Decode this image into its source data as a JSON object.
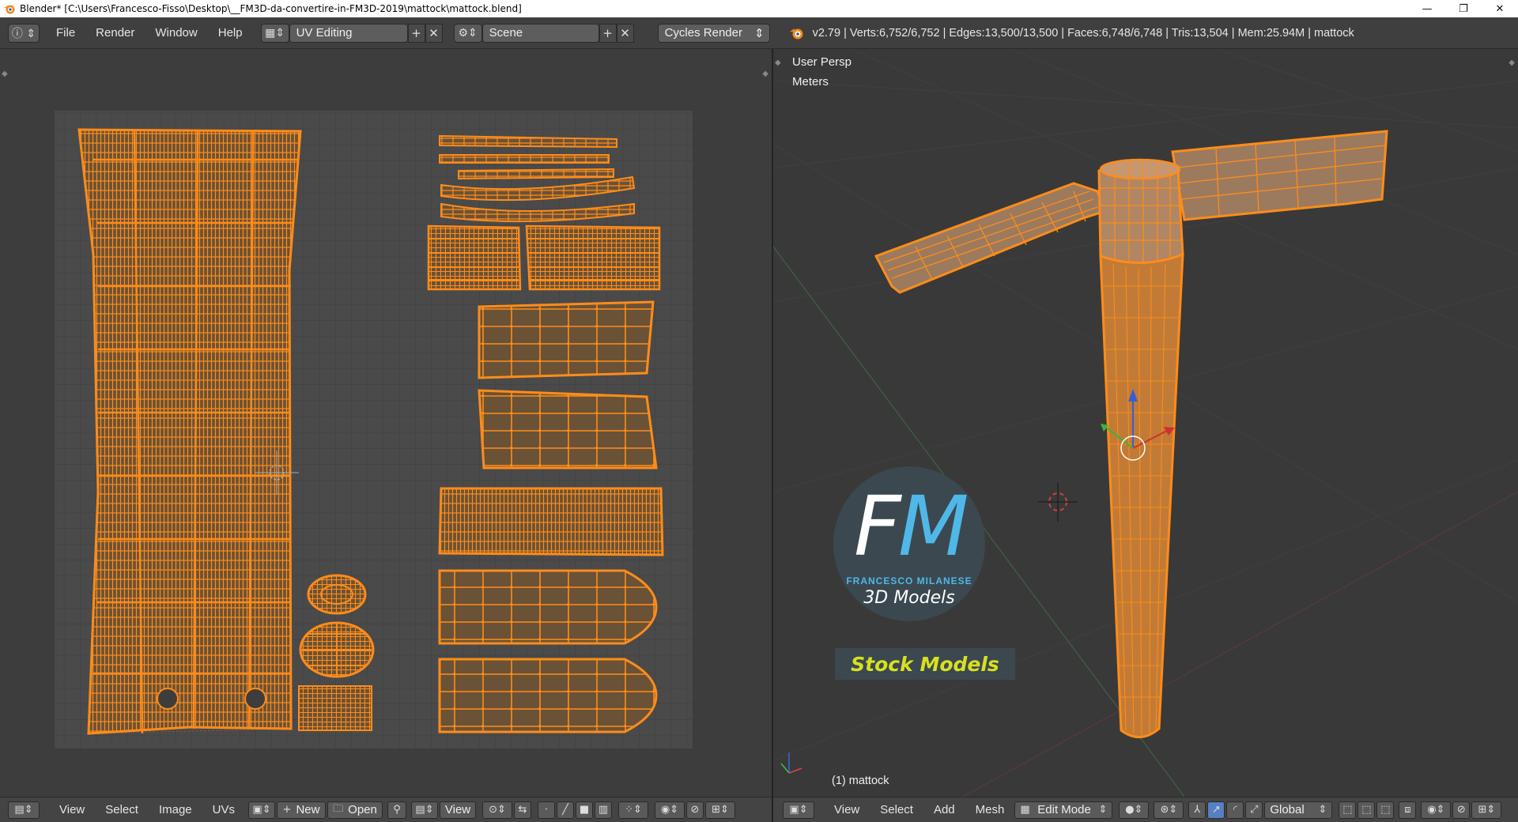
{
  "window": {
    "title": "Blender* [C:\\Users\\Francesco-Fisso\\Desktop\\__FM3D-da-convertire-in-FM3D-2019\\mattock\\mattock.blend]",
    "minimize": "—",
    "maximize": "❐",
    "close": "✕"
  },
  "header": {
    "menus": [
      "File",
      "Render",
      "Window",
      "Help"
    ],
    "screen_layout": "UV Editing",
    "scene": "Scene",
    "render_engine": "Cycles Render",
    "stats": "v2.79 | Verts:6,752/6,752 | Edges:13,500/13,500 | Faces:6,748/6,748 | Tris:13,504 | Mem:25.94M | mattock"
  },
  "viewport": {
    "view_name": "User Persp",
    "units": "Meters",
    "object_label": "(1) mattock",
    "watermark": {
      "logo": "FM",
      "brand": "FRANCESCO MILANESE",
      "subtitle": "3D Models",
      "badge": "Stock Models"
    }
  },
  "uv_footer": {
    "menus": [
      "View",
      "Select",
      "Image",
      "UVs"
    ],
    "new_label": "New",
    "open_label": "Open",
    "view_label": "View"
  },
  "vp_footer": {
    "menus": [
      "View",
      "Select",
      "Add",
      "Mesh"
    ],
    "mode": "Edit Mode",
    "orientation": "Global"
  },
  "colors": {
    "mesh": "#ff8c1a",
    "uv_face": "#6a5236",
    "accent": "#4fb8e8",
    "badge_text": "#d8e020"
  }
}
